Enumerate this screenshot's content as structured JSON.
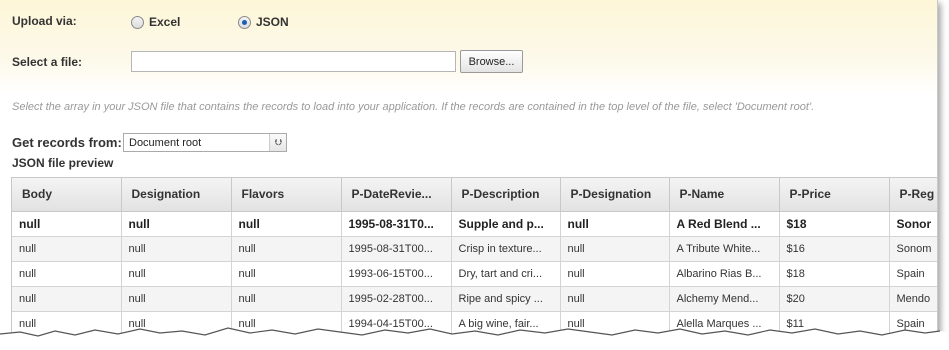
{
  "upload": {
    "label": "Upload via:",
    "options": [
      "Excel",
      "JSON"
    ],
    "selected": "JSON"
  },
  "file": {
    "label": "Select a file:",
    "value": "",
    "browse_label": "Browse..."
  },
  "hint_text": "Select the array in your JSON file that contains the records to load into your application. If the records are contained in the top level of the file, select 'Document root'.",
  "records": {
    "label": "Get records from:",
    "selected": "Document root"
  },
  "preview": {
    "title": "JSON file preview",
    "columns": [
      "Body",
      "Designation",
      "Flavors",
      "P-DateRevie...",
      "P-Description",
      "P-Designation",
      "P-Name",
      "P-Price",
      "P-Reg"
    ],
    "rows": [
      [
        "null",
        "null",
        "null",
        "1995-08-31T0...",
        "Supple and p...",
        "null",
        "A Red Blend ...",
        "$18",
        "Sonor"
      ],
      [
        "null",
        "null",
        "null",
        "1995-08-31T00...",
        "Crisp in texture...",
        "null",
        "A Tribute White...",
        "$16",
        "Sonom"
      ],
      [
        "null",
        "null",
        "null",
        "1993-06-15T00...",
        "Dry, tart and cri...",
        "null",
        "Albarino Rias B...",
        "$18",
        "Spain"
      ],
      [
        "null",
        "null",
        "null",
        "1995-02-28T00...",
        "Ripe and spicy ...",
        "null",
        "Alchemy Mend...",
        "$20",
        "Mendo"
      ],
      [
        "null",
        "null",
        "null",
        "1994-04-15T00...",
        "A big wine, fair...",
        "null",
        "Alella Marques ...",
        "$11",
        "Spain"
      ]
    ]
  }
}
